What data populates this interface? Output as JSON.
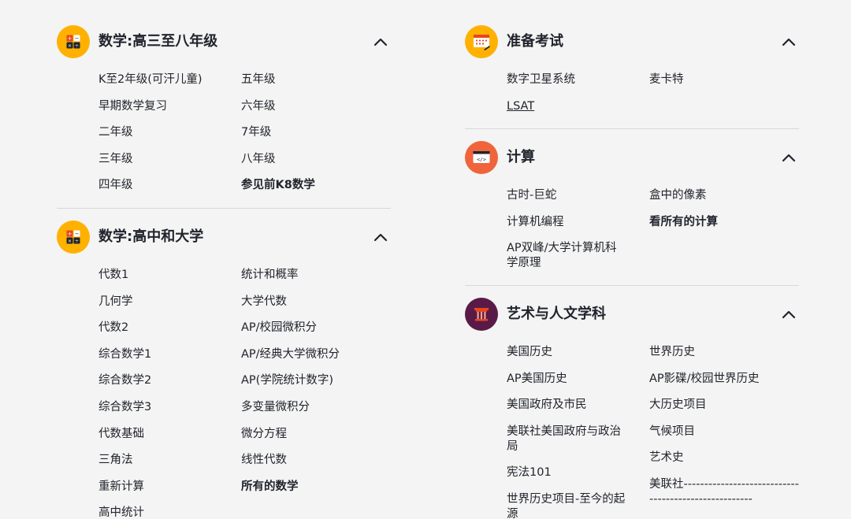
{
  "sections": {
    "math_k8": {
      "title": "数学:高三至八年级",
      "col1": [
        "K至2年级(可汗儿童)",
        "早期数学复习",
        "二年级",
        "三年级",
        "四年级"
      ],
      "col2": [
        "五年级",
        "六年级",
        "7年级",
        "八年级"
      ],
      "see_all": "参见前K8数学"
    },
    "math_hs": {
      "title": "数学:高中和大学",
      "col1": [
        "代数1",
        "几何学",
        "代数2",
        "综合数学1",
        "综合数学2",
        "综合数学3",
        "代数基础",
        "三角法",
        "重新计算",
        "高中统计"
      ],
      "col2": [
        "统计和概率",
        "大学代数",
        "AP/校园微积分",
        "AP/经典大学微积分",
        "AP(学院统计数字)",
        "多变量微积分",
        "微分方程",
        "线性代数"
      ],
      "see_all": "所有的数学"
    },
    "test_prep": {
      "title": "准备考试",
      "col1": [
        "数字卫星系统",
        "LSAT"
      ],
      "col2": [
        "麦卡特"
      ]
    },
    "computing": {
      "title": "计算",
      "col1": [
        "古时-巨蛇",
        "计算机编程",
        "AP双峰/大学计算机科学原理"
      ],
      "col2": [
        "盒中的像素"
      ],
      "see_all": "看所有的计算"
    },
    "arts": {
      "title": "艺术与人文学科",
      "col1": [
        "美国历史",
        "AP美国历史",
        "美国政府及市民",
        "美联社美国政府与政治局",
        "宪法101",
        "世界历史项目-至今的起源"
      ],
      "col2": [
        "世界历史",
        "AP影碟/校园世界历史",
        "大历史项目",
        "气候项目",
        "艺术史",
        "美联社-----------------------------------------------------"
      ]
    }
  },
  "icons": {
    "math_k8": "math-blocks-icon",
    "math_hs": "math-blocks-icon",
    "test_prep": "calendar-test-icon",
    "computing": "code-window-icon",
    "arts": "column-pillar-icon",
    "collapse": "chevron-up-icon"
  },
  "colors": {
    "background": "#f4f4f4",
    "math": "#ffb100",
    "test_prep": "#ffb100",
    "computing": "#f0643b",
    "arts": "#5a1a47",
    "text": "#21242c",
    "divider": "#d6d8da"
  }
}
